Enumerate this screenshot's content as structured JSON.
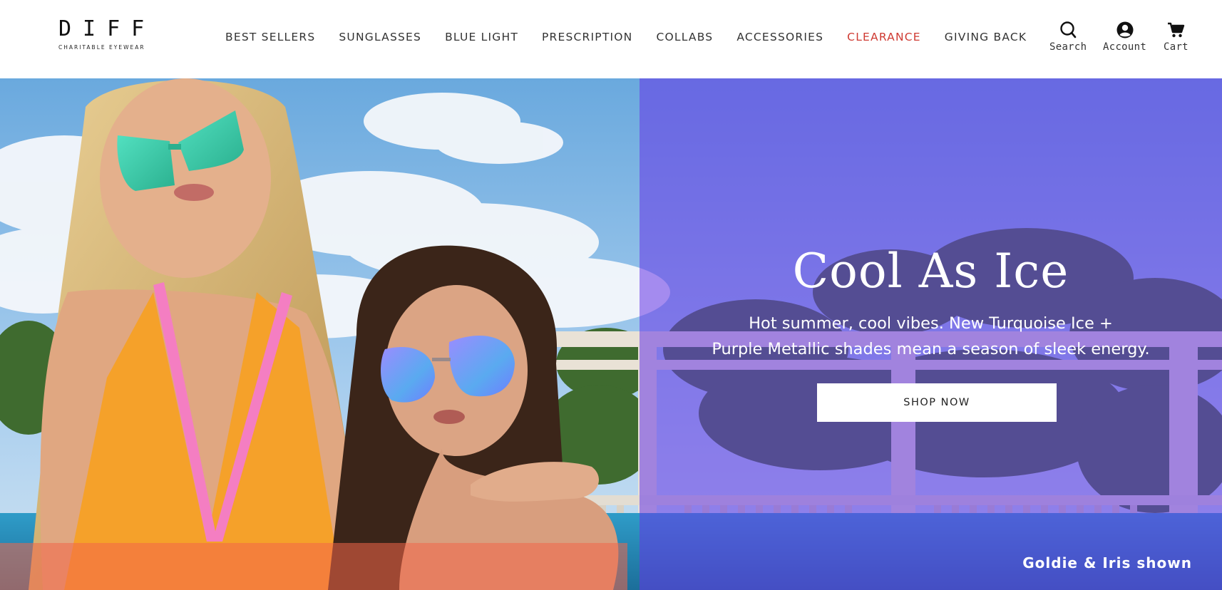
{
  "logo": {
    "name": "DIFF",
    "tagline": "CHARITABLE EYEWEAR"
  },
  "nav": [
    {
      "label": "BEST SELLERS"
    },
    {
      "label": "SUNGLASSES"
    },
    {
      "label": "BLUE LIGHT"
    },
    {
      "label": "PRESCRIPTION"
    },
    {
      "label": "COLLABS"
    },
    {
      "label": "ACCESSORIES"
    },
    {
      "label": "CLEARANCE",
      "color": "#cf3a32"
    },
    {
      "label": "GIVING BACK"
    }
  ],
  "utility": {
    "search": {
      "label": "Search",
      "icon": "search-icon"
    },
    "account": {
      "label": "Account",
      "icon": "account-icon"
    },
    "cart": {
      "label": "Cart",
      "icon": "cart-icon"
    }
  },
  "hero": {
    "title": "Cool As Ice",
    "subtitle_line1": "Hot summer, cool vibes. New Turquoise Ice +",
    "subtitle_line2": "Purple Metallic shades mean a season of sleek energy.",
    "cta": "SHOP NOW",
    "caption": "Goldie & Iris shown",
    "overlay_color": "#6634e6"
  }
}
